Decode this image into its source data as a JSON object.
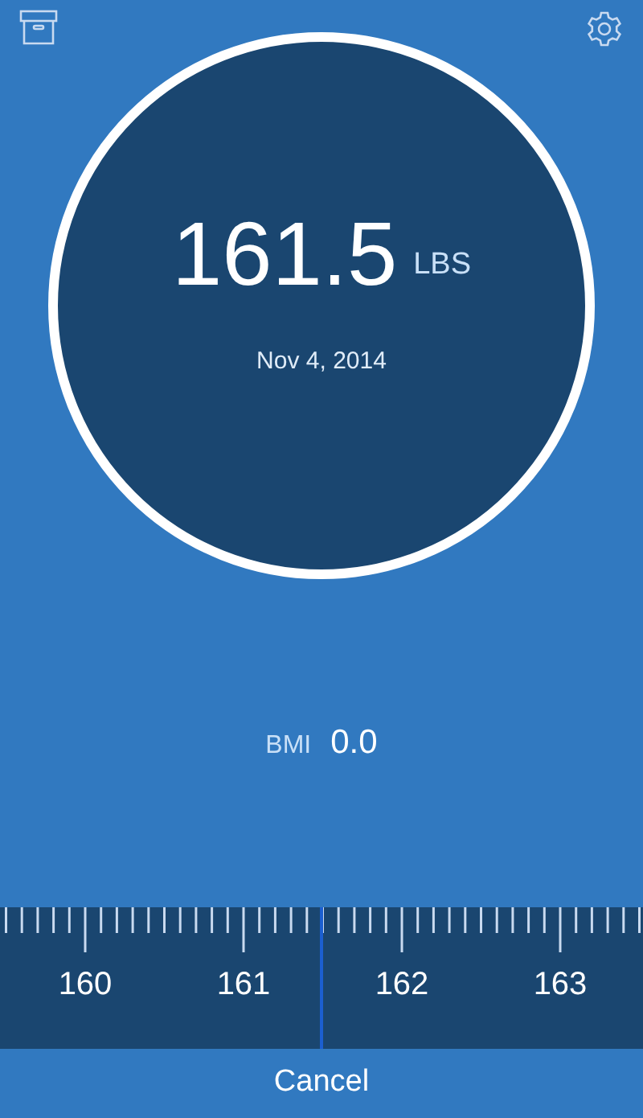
{
  "reading": {
    "value": "161.5",
    "unit": "LBS",
    "date": "Nov 4, 2014"
  },
  "bmi": {
    "label": "BMI",
    "value": "0.0"
  },
  "ruler": {
    "labels": [
      "160",
      "161",
      "162",
      "163"
    ]
  },
  "cancel_button": "Cancel"
}
